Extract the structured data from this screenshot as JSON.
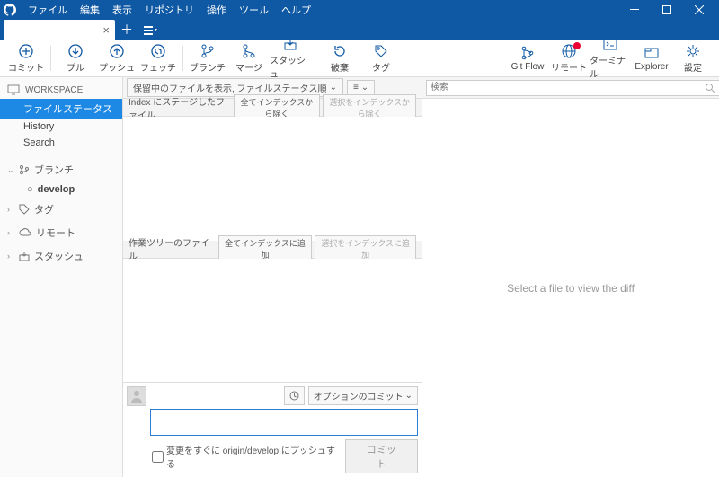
{
  "menu": [
    "ファイル",
    "編集",
    "表示",
    "リポジトリ",
    "操作",
    "ツール",
    "ヘルプ"
  ],
  "tab": {
    "name": "",
    "close": "×"
  },
  "toolbar": {
    "left": [
      {
        "id": "commit",
        "label": "コミット"
      },
      {
        "id": "pull",
        "label": "プル"
      },
      {
        "id": "push",
        "label": "プッシュ"
      },
      {
        "id": "fetch",
        "label": "フェッチ"
      },
      {
        "id": "branch",
        "label": "ブランチ"
      },
      {
        "id": "merge",
        "label": "マージ"
      },
      {
        "id": "stash",
        "label": "スタッシュ"
      },
      {
        "id": "discard",
        "label": "破棄"
      },
      {
        "id": "tag",
        "label": "タグ"
      }
    ],
    "right": [
      {
        "id": "gitflow",
        "label": "Git Flow"
      },
      {
        "id": "remote",
        "label": "リモート",
        "badge": true
      },
      {
        "id": "terminal",
        "label": "ターミナル"
      },
      {
        "id": "explorer",
        "label": "Explorer"
      },
      {
        "id": "settings",
        "label": "設定"
      }
    ]
  },
  "sidebar": {
    "workspace": "WORKSPACE",
    "items": [
      "ファイルステータス",
      "History",
      "Search"
    ],
    "sections": [
      {
        "icon": "branch",
        "label": "ブランチ",
        "expanded": true,
        "children": [
          "develop"
        ]
      },
      {
        "icon": "tag",
        "label": "タグ"
      },
      {
        "icon": "remote",
        "label": "リモート"
      },
      {
        "icon": "stash",
        "label": "スタッシュ"
      }
    ]
  },
  "filter": {
    "pending": "保留中のファイルを表示, ファイルステータス順"
  },
  "staged": {
    "header": "Index にステージしたファイル",
    "unstage_all": "全てインデックスから除く",
    "unstage_sel": "選択をインデックスから除く"
  },
  "unstaged": {
    "header": "作業ツリーのファイル",
    "stage_all": "全てインデックスに追加",
    "stage_sel": "選択をインデックスに追加"
  },
  "search": {
    "placeholder": "検索"
  },
  "diff": {
    "placeholder": "Select a file to view the diff"
  },
  "commit": {
    "options_label": "オプションのコミット",
    "push_immediate": "変更をすぐに origin/develop にプッシュする",
    "button": "コミット"
  }
}
